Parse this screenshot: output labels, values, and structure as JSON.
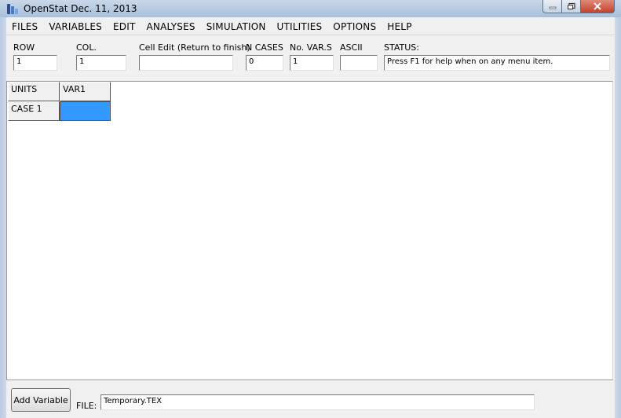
{
  "window": {
    "title": "OpenStat Dec. 11, 2013"
  },
  "menu": [
    "FILES",
    "VARIABLES",
    "EDIT",
    "ANALYSES",
    "SIMULATION",
    "UTILITIES",
    "OPTIONS",
    "HELP"
  ],
  "toolbar": {
    "row": {
      "label": "ROW",
      "value": "1"
    },
    "col": {
      "label": "COL.",
      "value": "1"
    },
    "cell_edit": {
      "label": "Cell Edit (Return to finish)",
      "value": ""
    },
    "n_cases": {
      "label": "N CASES",
      "value": "0"
    },
    "n_vars": {
      "label": "No. VAR.S",
      "value": "1"
    },
    "ascii": {
      "label": "ASCII",
      "value": ""
    },
    "status": {
      "label": "STATUS:",
      "value": "Press F1 for help when on any menu item."
    }
  },
  "grid": {
    "header_units": "UNITS",
    "columns": [
      "VAR1"
    ],
    "rows": [
      {
        "label": "CASE 1",
        "values": [
          ""
        ]
      }
    ]
  },
  "footer": {
    "add_variable_label": "Add Variable",
    "file_label": "FILE:",
    "file_value": "Temporary.TEX"
  },
  "colors": {
    "selected_cell": "#3399ff",
    "titlebar": "#b8cbe1"
  },
  "icons": {
    "app": "openstat-app-icon",
    "minimize": "minimize-icon",
    "maximize": "maximize-icon",
    "close": "close-icon"
  }
}
